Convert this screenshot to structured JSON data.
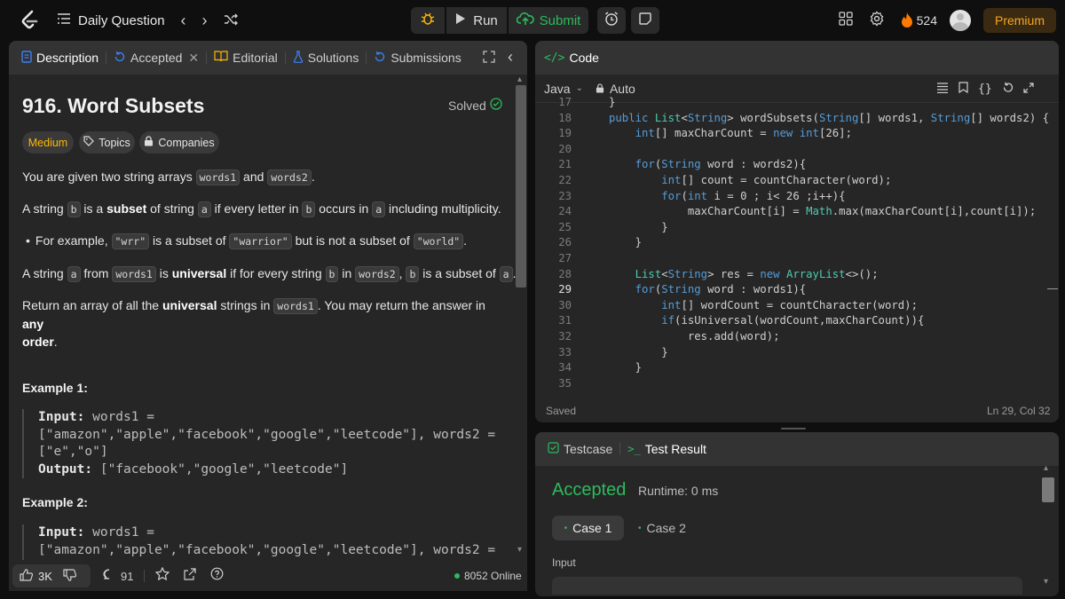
{
  "topbar": {
    "app_icon": "leetcode-logo",
    "daily_question": "Daily Question",
    "run": "Run",
    "submit": "Submit",
    "streak_count": "524",
    "premium": "Premium"
  },
  "left_tabs": [
    {
      "label": "Description",
      "icon": "description-icon",
      "active": true
    },
    {
      "label": "Accepted",
      "icon": "history-icon",
      "closable": true
    },
    {
      "label": "Editorial",
      "icon": "book-icon"
    },
    {
      "label": "Solutions",
      "icon": "flask-icon"
    },
    {
      "label": "Submissions",
      "icon": "history-icon"
    }
  ],
  "problem": {
    "title": "916. Word Subsets",
    "solved": "Solved",
    "difficulty": "Medium",
    "difficulty_color": "#ffb800",
    "topics": "Topics",
    "companies": "Companies",
    "p1_pre": "You are given two string arrays ",
    "p1_c1": "words1",
    "p1_mid": " and ",
    "p1_c2": "words2",
    "p1_end": ".",
    "p2_a": "A string ",
    "p2_c1": "b",
    "p2_b": " is a ",
    "p2_bold": "subset",
    "p2_c": " of string ",
    "p2_c2": "a",
    "p2_d": " if every letter in ",
    "p2_c3": "b",
    "p2_e": " occurs in ",
    "p2_c4": "a",
    "p2_f": " including multiplicity.",
    "bullet_a": "For example, ",
    "bullet_c1": "\"wrr\"",
    "bullet_b": " is a subset of ",
    "bullet_c2": "\"warrior\"",
    "bullet_c": " but is not a subset of ",
    "bullet_c3": "\"world\"",
    "bullet_d": ".",
    "p3_a": "A string ",
    "p3_c1": "a",
    "p3_b": " from ",
    "p3_c2": "words1",
    "p3_c": " is ",
    "p3_bold": "universal",
    "p3_d": " if for every string ",
    "p3_c3": "b",
    "p3_e": " in ",
    "p3_c4": "words2",
    "p3_f": ", ",
    "p3_c5": "b",
    "p3_g": " is a subset of ",
    "p3_c6": "a",
    "p3_h": ".",
    "p4_a": "Return an array of all the ",
    "p4_bold": "universal",
    "p4_b": " strings in ",
    "p4_c1": "words1",
    "p4_c": ". You may return the answer in ",
    "p4_bold2": "any",
    "p4_bold3": "order",
    "p4_end": ".",
    "example1_title": "Example 1:",
    "example1_input_label": "Input:",
    "example1_input_1": " words1 =",
    "example1_input_2": "[\"amazon\",\"apple\",\"facebook\",\"google\",\"leetcode\"], words2 =",
    "example1_input_3": "[\"e\",\"o\"]",
    "example1_output_label": "Output:",
    "example1_output": " [\"facebook\",\"google\",\"leetcode\"]",
    "example2_title": "Example 2:",
    "example2_input_label": "Input:",
    "example2_input_1": " words1 =",
    "example2_input_2": "[\"amazon\",\"apple\",\"facebook\",\"google\",\"leetcode\"], words2 ="
  },
  "left_footer": {
    "likes": "3K",
    "comments": "91",
    "online": "8052 Online"
  },
  "code_panel": {
    "title": "Code",
    "language": "Java",
    "auto": "Auto",
    "saved": "Saved",
    "cursor": "Ln 29, Col 32",
    "lines": [
      {
        "n": "17",
        "t": "}"
      },
      {
        "n": "18",
        "t": "public List<String> wordSubsets(String[] words1, String[] words2) {"
      },
      {
        "n": "19",
        "t": "    int[] maxCharCount = new int[26];"
      },
      {
        "n": "20",
        "t": ""
      },
      {
        "n": "21",
        "t": "    for(String word : words2){"
      },
      {
        "n": "22",
        "t": "        int[] count = countCharacter(word);"
      },
      {
        "n": "23",
        "t": "        for(int i = 0 ; i< 26 ;i++){"
      },
      {
        "n": "24",
        "t": "            maxCharCount[i] = Math.max(maxCharCount[i],count[i]);"
      },
      {
        "n": "25",
        "t": "        }"
      },
      {
        "n": "26",
        "t": "    }"
      },
      {
        "n": "27",
        "t": ""
      },
      {
        "n": "28",
        "t": "    List<String> res = new ArrayList<>();"
      },
      {
        "n": "29",
        "t": "    for(String word : words1){"
      },
      {
        "n": "30",
        "t": "        int[] wordCount = countCharacter(word);"
      },
      {
        "n": "31",
        "t": "        if(isUniversal(wordCount,maxCharCount)){"
      },
      {
        "n": "32",
        "t": "            res.add(word);"
      },
      {
        "n": "33",
        "t": "        }"
      },
      {
        "n": "34",
        "t": "    }"
      },
      {
        "n": "35",
        "t": ""
      }
    ]
  },
  "result_panel": {
    "tab_testcase": "Testcase",
    "tab_result": "Test Result",
    "status": "Accepted",
    "status_color": "#2cbb5d",
    "runtime": "Runtime: 0 ms",
    "case1": "Case 1",
    "case2": "Case 2",
    "input_label": "Input"
  }
}
